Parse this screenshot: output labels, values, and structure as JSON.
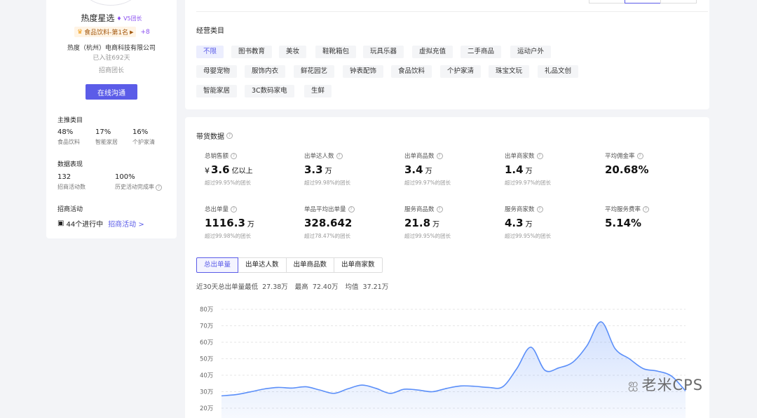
{
  "left_panel": {
    "name": "热度星选",
    "badge": "V5团长",
    "rank": "食品饮料-第1名",
    "rank_more": "+8",
    "company": "热度（杭州）电商科技有限公司",
    "days": "已入驻692天",
    "role": "招商团长",
    "contact_button": "在线沟通",
    "main_category_title": "主推类目",
    "main_categories": [
      {
        "value": "48%",
        "label": "食品饮料"
      },
      {
        "value": "17%",
        "label": "智能家居"
      },
      {
        "value": "16%",
        "label": "个护家清"
      }
    ],
    "data_title": "数据表现",
    "data_items": [
      {
        "value": "132",
        "label": "招商活动数"
      },
      {
        "value": "100%",
        "label": "历史活动完成率"
      }
    ],
    "activity_title": "招商活动",
    "activity_count": "44个进行中",
    "activity_link": "招商活动 >"
  },
  "categories": {
    "title": "经营类目",
    "items": [
      "不限",
      "图书教育",
      "美妆",
      "鞋靴箱包",
      "玩具乐器",
      "虚拟充值",
      "二手商品",
      "运动户外",
      "母婴宠物",
      "服饰内衣",
      "鲜花园艺",
      "钟表配饰",
      "食品饮料",
      "个护家清",
      "珠宝文玩",
      "礼品文创",
      "智能家居",
      "3C数码家电",
      "生鲜"
    ],
    "active": "不限"
  },
  "sales": {
    "title": "带货数据",
    "metrics": [
      {
        "label": "总销售额",
        "prefix": "¥",
        "value": "3.6",
        "unit": "亿以上",
        "sub": "超过99.95%的团长",
        "help": true
      },
      {
        "label": "出单达人数",
        "prefix": "",
        "value": "3.3",
        "unit": "万",
        "sub": "超过99.98%的团长",
        "help": true
      },
      {
        "label": "出单商品数",
        "prefix": "",
        "value": "3.4",
        "unit": "万",
        "sub": "超过99.97%的团长",
        "help": true
      },
      {
        "label": "出单商家数",
        "prefix": "",
        "value": "1.4",
        "unit": "万",
        "sub": "超过99.97%的团长",
        "help": true
      },
      {
        "label": "平均佣金率",
        "prefix": "",
        "value": "20.68%",
        "unit": "",
        "sub": "",
        "help": true
      },
      {
        "label": "总出单量",
        "prefix": "",
        "value": "1116.3",
        "unit": "万",
        "sub": "超过99.98%的团长",
        "help": true
      },
      {
        "label": "单品平均出单量",
        "prefix": "",
        "value": "328.642",
        "unit": "",
        "sub": "超过78.47%的团长",
        "help": true
      },
      {
        "label": "服务商品数",
        "prefix": "",
        "value": "21.8",
        "unit": "万",
        "sub": "超过99.95%的团长",
        "help": true
      },
      {
        "label": "服务商家数",
        "prefix": "",
        "value": "4.3",
        "unit": "万",
        "sub": "超过99.95%的团长",
        "help": true
      },
      {
        "label": "平均服务费率",
        "prefix": "",
        "value": "5.14%",
        "unit": "",
        "sub": "",
        "help": true
      }
    ],
    "tabs": [
      "总出单量",
      "出单达人数",
      "出单商品数",
      "出单商家数"
    ],
    "active_tab": "总出单量",
    "summary": {
      "lead": "近30天总出单量最低",
      "min": "27.38万",
      "max_label": "最高",
      "max": "72.40万",
      "avg_label": "均值",
      "avg": "37.21万"
    }
  },
  "chart_data": {
    "type": "area",
    "y_ticks": [
      "80万",
      "70万",
      "60万",
      "50万",
      "40万",
      "30万",
      "20万"
    ],
    "ylim": [
      20,
      80
    ],
    "grid": true,
    "color": "#5b8ff9",
    "values": [
      27.5,
      28.2,
      29.8,
      31.6,
      32.6,
      32.2,
      33.0,
      31.0,
      29.0,
      31.8,
      34.0,
      32.0,
      29.0,
      31.5,
      31.0,
      30.0,
      32.0,
      33.5,
      33.3,
      32.6,
      33.0,
      44.0,
      57.0,
      43.0,
      44.5,
      48.0,
      58.0,
      72.4,
      56.0,
      50.0,
      44.0,
      42.5,
      39.5,
      30.5
    ]
  },
  "watermark": {
    "icon": "wechat-icon",
    "text": "老米CPS"
  }
}
